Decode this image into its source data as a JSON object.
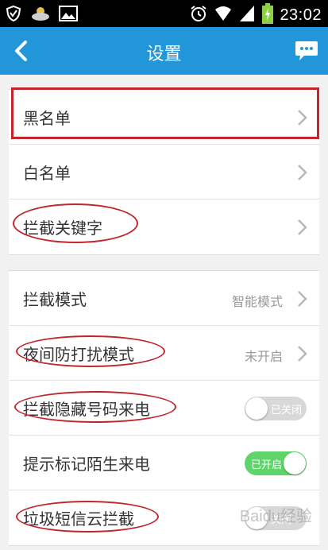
{
  "statusbar": {
    "time": "23:02",
    "left_icons": [
      "shield-icon",
      "weather-cloud-icon",
      "image-icon"
    ],
    "right_icons": [
      "alarm-icon",
      "wifi-icon",
      "signal-icon",
      "battery-charging-icon"
    ]
  },
  "header": {
    "title": "设置",
    "back_icon": "chevron-left-icon",
    "action_icon": "message-icon",
    "color": "#2196d9"
  },
  "group1": {
    "items": [
      {
        "label": "黑名单"
      },
      {
        "label": "白名单"
      },
      {
        "label": "拦截关键字"
      }
    ]
  },
  "group2": {
    "items": [
      {
        "label": "拦截模式",
        "value": "智能模式"
      },
      {
        "label": "夜间防打扰模式",
        "value": "未开启"
      },
      {
        "label": "拦截隐藏号码来电",
        "toggle_label": "已关闭",
        "toggle_on": false
      },
      {
        "label": "提示标记陌生来电",
        "toggle_label": "已开启",
        "toggle_on": true
      },
      {
        "label": "垃圾短信云拦截",
        "toggle_label": "关闭",
        "toggle_on": false
      }
    ]
  },
  "annotation_color": "#c0262d",
  "watermark": "Baidu经验"
}
